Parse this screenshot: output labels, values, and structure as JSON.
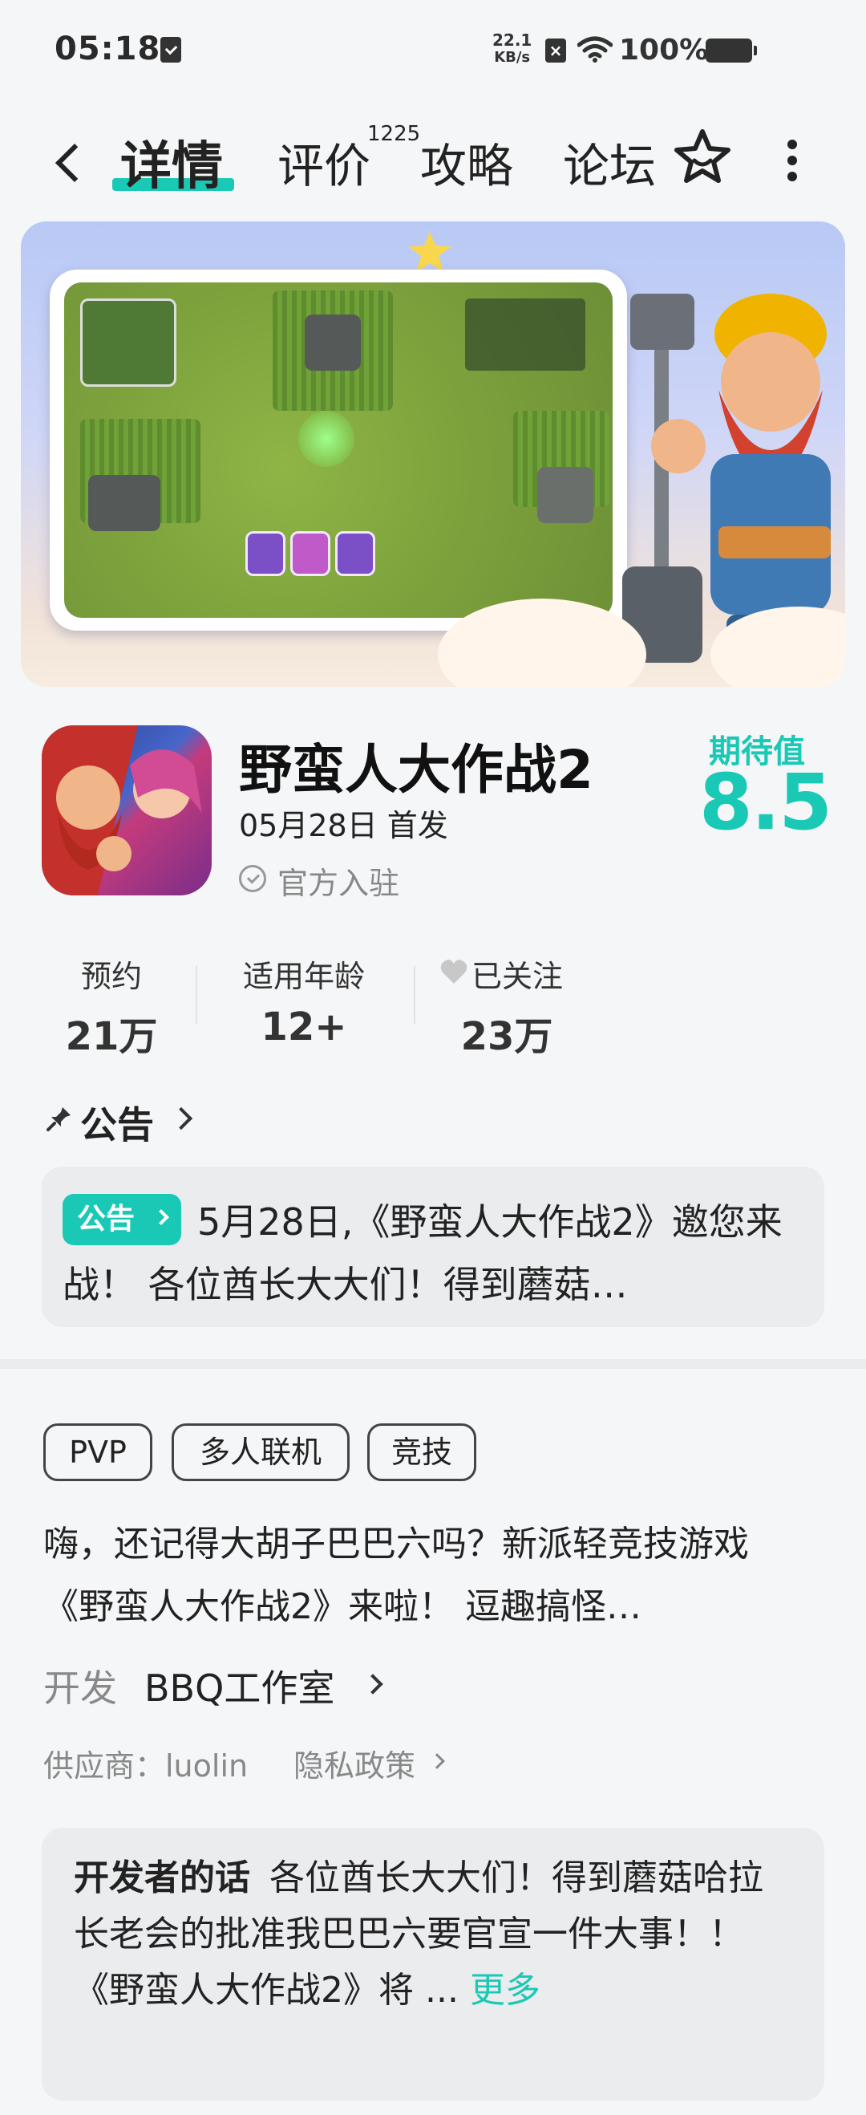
{
  "status_bar": {
    "time": "05:18",
    "net_speed_value": "22.1",
    "net_speed_unit": "KB/s",
    "battery": "100%"
  },
  "nav": {
    "tabs": [
      {
        "label": "详情",
        "active": true
      },
      {
        "label": "评价",
        "badge": "1225"
      },
      {
        "label": "攻略"
      },
      {
        "label": "论坛"
      }
    ]
  },
  "app": {
    "title": "野蛮人大作战2",
    "release": "05月28日 首发",
    "official": "官方入驻",
    "expect_label": "期待值",
    "expect_score": "8.5"
  },
  "stats": [
    {
      "label": "预约",
      "value": "21万"
    },
    {
      "label": "适用年龄",
      "value": "12+"
    },
    {
      "label": "已关注",
      "value": "23万"
    }
  ],
  "notice": {
    "title": "公告",
    "tag": "公告",
    "text": "5月28日,《野蛮人大作战2》邀您来战！ 各位酋长大大们！得到蘑菇…"
  },
  "tags": [
    "PVP",
    "多人联机",
    "竞技"
  ],
  "description": "嗨，还记得大胡子巴巴六吗？新派轻竞技游戏《野蛮人大作战2》来啦！ 逗趣搞怪…",
  "developer": {
    "label": "开发",
    "name": "BBQ工作室"
  },
  "supplier": "供应商：luolin",
  "privacy": "隐私政策",
  "dev_words": {
    "title": "开发者的话",
    "text": "各位酋长大大们！得到蘑菇哈拉长老会的批准我巴巴六要官宣一件大事！！《野蛮人大作战2》将 ... ",
    "more": "更多"
  },
  "colors": {
    "accent": "#1ac9b5"
  }
}
